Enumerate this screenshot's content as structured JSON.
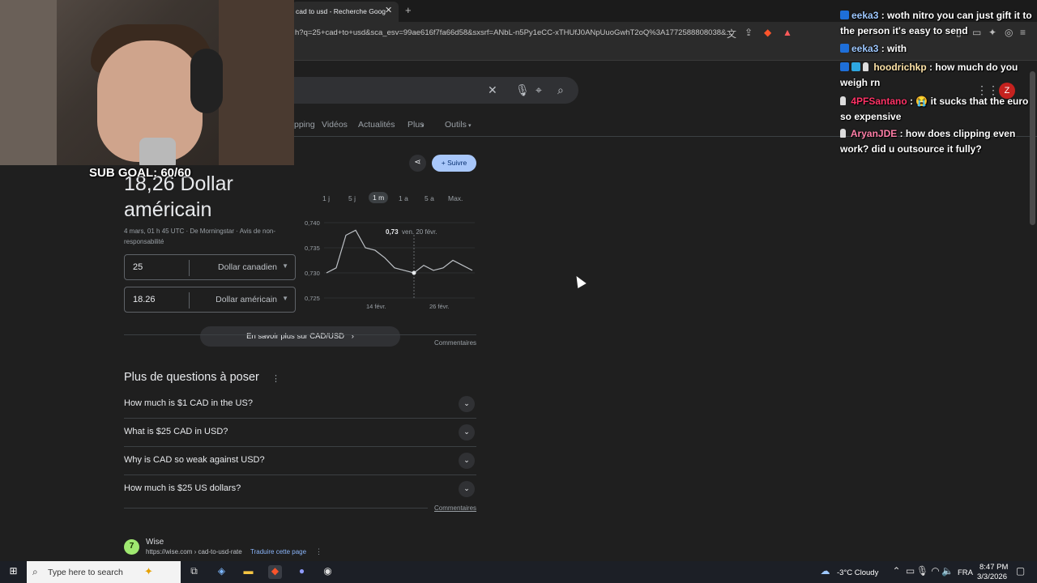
{
  "browser": {
    "tab_title": "cad to usd - Recherche Goog",
    "url": "h?q=25+cad+to+usd&sca_esv=99ae616f7fa66d58&sxsrf=ANbL-n5Py1eCC-xTHUfJ0ANpUuoGwhT2oQ%3A1772588808038&..."
  },
  "search": {
    "nav_tabs": [
      "pping",
      "Vidéos",
      "Actualités",
      "Plus",
      "Outils"
    ]
  },
  "result": {
    "converted_amount": "18,26 Dollar américain",
    "meta": "4 mars, 01 h 45 UTC · De Morningstar · Avis de non-responsabilité",
    "from_value": "25",
    "from_currency": "Dollar canadien",
    "to_value": "18.26",
    "to_currency": "Dollar américain",
    "learn_more": "En savoir plus sur CAD/USD",
    "follow_label": "Suivre",
    "time_ranges": [
      "1 j",
      "5 j",
      "1 m",
      "1 a",
      "5 a",
      "Max."
    ],
    "active_range": "1 m",
    "feedback": "Commentaires"
  },
  "chart_data": {
    "type": "line",
    "x": [
      "feb 3",
      "feb 5",
      "feb 7",
      "feb 9",
      "feb 11",
      "feb 13",
      "feb 15",
      "feb 17",
      "feb 19",
      "feb 20",
      "feb 22",
      "feb 24",
      "feb 26",
      "feb 28",
      "mar 2",
      "mar 3"
    ],
    "values": [
      0.73,
      0.731,
      0.7375,
      0.7385,
      0.735,
      0.7345,
      0.733,
      0.731,
      0.7305,
      0.73,
      0.7315,
      0.7305,
      0.731,
      0.7325,
      0.7315,
      0.7305
    ],
    "yticks": [
      "0,740",
      "0,735",
      "0,730",
      "0,725"
    ],
    "xticks": [
      "14 févr.",
      "26 févr."
    ],
    "ylim": [
      0.725,
      0.74
    ],
    "tooltip_value": "0,73",
    "tooltip_date": "ven. 20 févr."
  },
  "questions": {
    "title": "Plus de questions à poser",
    "items": [
      "How much is $1 CAD in the US?",
      "What is $25 CAD in USD?",
      "Why is CAD so weak against USD?",
      "How much is $25 US dollars?"
    ],
    "feedback": "Commentaires"
  },
  "next_result": {
    "site": "Wise",
    "url": "https://wise.com › cad-to-usd-rate",
    "translate": "Traduire cette page"
  },
  "stream": {
    "sub_goal": "SUB GOAL: 60/60"
  },
  "chat": [
    {
      "user": "eeka3",
      "user_color": "#9ec8ff",
      "text": ": woth nitro you can just gift it to the person it's easy to send"
    },
    {
      "user": "eeka3",
      "user_color": "#9ec8ff",
      "text": ": with"
    },
    {
      "user": "hoodrichkp",
      "user_color": "#ffe4a8",
      "text": ": how much do you weigh rn"
    },
    {
      "user": "4PFSantano",
      "user_color": "#ff3366",
      "text": ": 😭 it sucks that the euro so expensive"
    },
    {
      "user": "AryanJDE",
      "user_color": "#ff7fa8",
      "text": ": how does clipping even work? did u outsource it fully?"
    }
  ],
  "taskbar": {
    "search_placeholder": "Type here to search",
    "weather": "-3°C  Cloudy",
    "lang": "FRA",
    "time": "8:47 PM",
    "date": "3/3/2026"
  }
}
